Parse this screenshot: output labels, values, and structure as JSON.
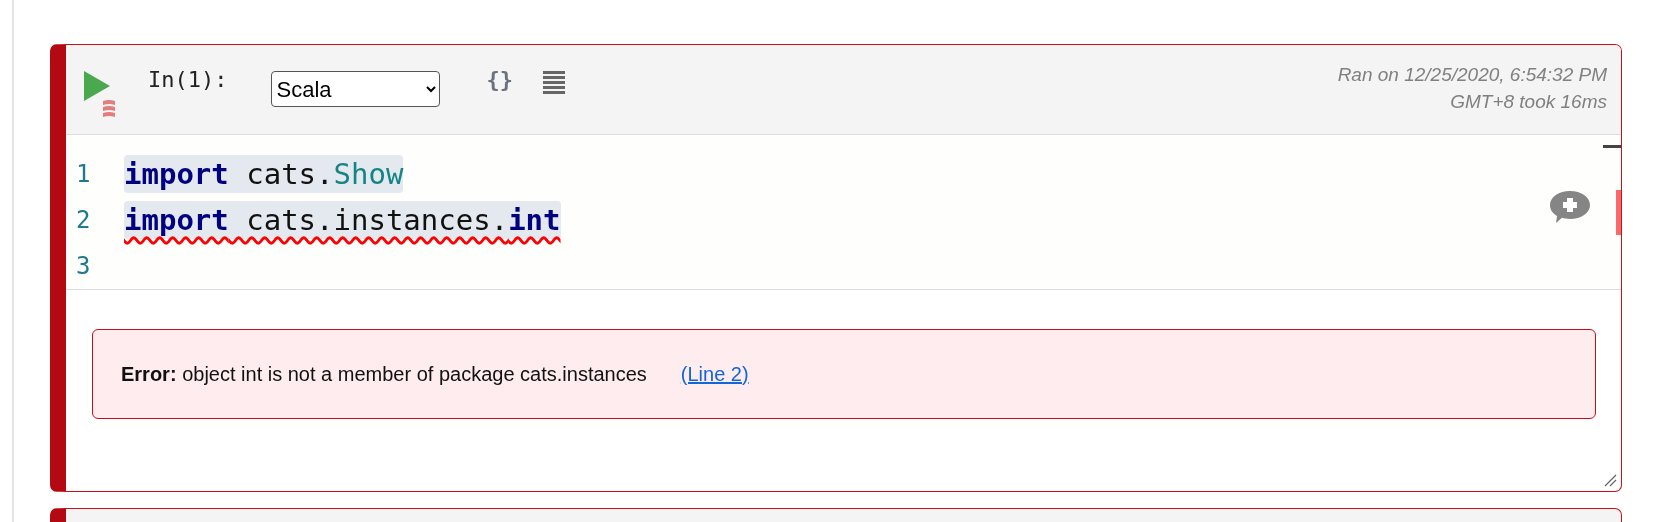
{
  "cell": {
    "prompt": "In(1):",
    "language": "Scala",
    "format_button": "{}",
    "status": [
      "Ran on 12/25/2020, 6:54:32 PM",
      "GMT+8 took 16ms"
    ],
    "lines": [
      {
        "number": "1",
        "highlighted": true,
        "error": false,
        "tokens": [
          {
            "kind": "keyword",
            "text": "import"
          },
          {
            "kind": "plain",
            "text": " cats."
          },
          {
            "kind": "type",
            "text": "Show"
          }
        ]
      },
      {
        "number": "2",
        "highlighted": true,
        "error": true,
        "tokens": [
          {
            "kind": "keyword",
            "text": "import"
          },
          {
            "kind": "plain",
            "text": " cats.instances."
          },
          {
            "kind": "keyword",
            "text": "int"
          }
        ]
      },
      {
        "number": "3"
      }
    ],
    "error": {
      "label": "Error:",
      "message": "object int is not a member of package cats.instances",
      "link": "(Line 2)"
    }
  }
}
